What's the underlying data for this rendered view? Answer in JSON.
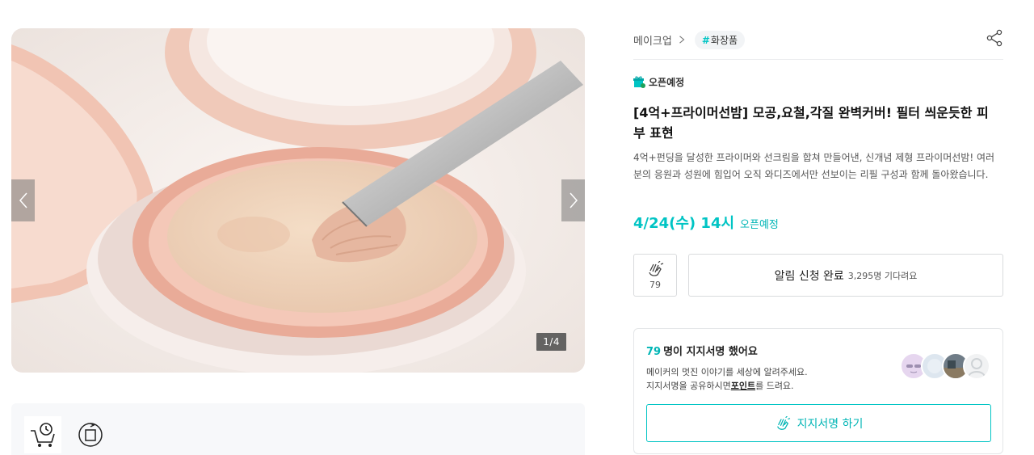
{
  "gallery": {
    "counter": "1/4",
    "prev_icon": "chevron-left-icon",
    "next_icon": "chevron-right-icon"
  },
  "features": [
    {
      "icon": "cart-clock-icon",
      "label": ""
    },
    {
      "icon": "box-return-icon",
      "label": ""
    }
  ],
  "breadcrumb": {
    "category": "메이크업",
    "tag_hash": "#",
    "tag": "화장품"
  },
  "share_icon": "share-icon",
  "badge": "오픈예정",
  "title": "[4억+프라이머선밤] 모공,요철,각질 완벽커버! 필터 씌운듯한 피부 표현",
  "description": "4억+펀딩을 달성한 프라이머와 선크림을 합쳐 만들어낸, 신개념 제형 프라이머선밤! 여러분의 응원과 성원에 힘입어 오직 와디즈에서만 선보이는 리필 구성과 함께 돌아왔습니다.",
  "open": {
    "date": "4/24(수) 14시",
    "label": "오픈예정"
  },
  "clap": {
    "count": "79"
  },
  "notify": {
    "label": "알림 신청 완료",
    "sub": "3,295명 기다려요"
  },
  "support": {
    "count": "79",
    "head": "명이 지지서명 했어요",
    "line1": "메이커의 멋진 이야기를 세상에 알려주세요.",
    "line2_pre": "지지서명을 공유하시면",
    "line2_bold": "포인트",
    "line2_post": "를 드려요.",
    "button": "지지서명 하기"
  },
  "colors": {
    "accent": "#00c4c4",
    "text": "#212121",
    "border": "#d9dbdd"
  }
}
